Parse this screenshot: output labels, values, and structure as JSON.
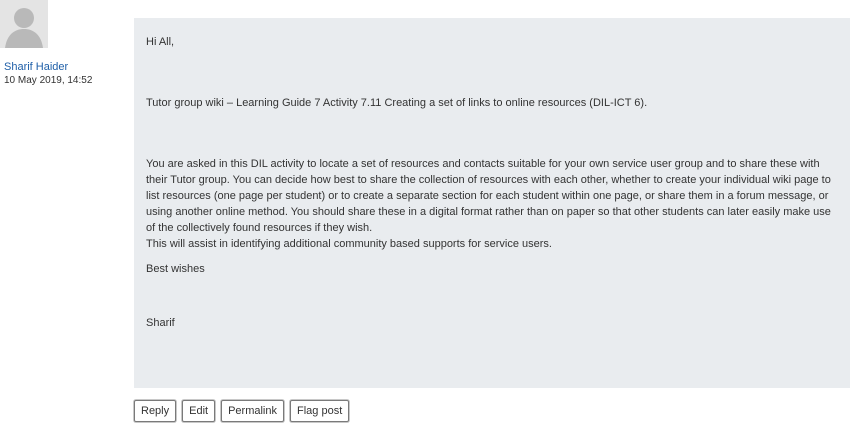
{
  "author": {
    "name": "Sharif Haider",
    "date": "10 May 2019, 14:52",
    "avatar_icon": "default-user-avatar"
  },
  "post": {
    "greeting": "Hi All,",
    "subject": "Tutor group wiki – Learning Guide 7 Activity 7.11 Creating a set of links to online resources (DIL-ICT 6).",
    "main_paragraph": "You are asked in this DIL activity to locate a set of resources and contacts suitable for your own service user group and to share these with their Tutor group. You can decide how best to share the collection of resources with each other, whether to create your individual wiki page to list resources (one page per student) or to create a separate section for each student within one page, or share them in a forum message, or using another online method. You  should share these in a digital format rather than on paper so that other students can later easily make use of the collectively found resources if they wish.",
    "assist": "This will assist in identifying additional community based supports for service users.",
    "wishes": "Best wishes",
    "signature": "Sharif"
  },
  "actions": {
    "reply": "Reply",
    "edit": "Edit",
    "permalink": "Permalink",
    "flag": "Flag post"
  },
  "colors": {
    "post_background": "#e9ecef",
    "author_link": "#1f5fa8"
  }
}
